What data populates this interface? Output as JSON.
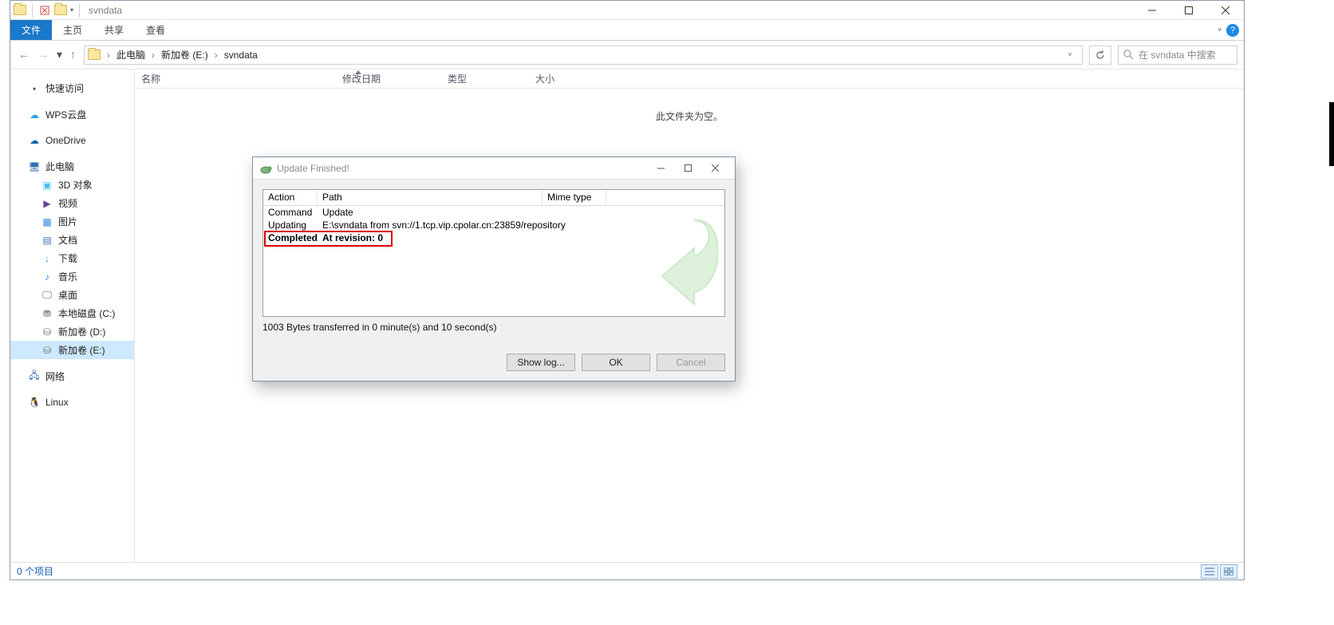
{
  "titlebar": {
    "title": "svndata"
  },
  "ribbon": {
    "file": "文件",
    "home": "主页",
    "share": "共享",
    "view": "查看"
  },
  "breadcrumb": {
    "parts": [
      "此电脑",
      "新加卷 (E:)",
      "svndata"
    ]
  },
  "search": {
    "placeholder": "在 svndata 中搜索"
  },
  "nav": {
    "quick": "快速访问",
    "wps": "WPS云盘",
    "onedrive": "OneDrive",
    "thispc": "此电脑",
    "pc_children": {
      "threeD": "3D 对象",
      "videos": "视频",
      "pictures": "图片",
      "documents": "文档",
      "downloads": "下载",
      "music": "音乐",
      "desktop": "桌面",
      "c": "本地磁盘 (C:)",
      "d": "新加卷 (D:)",
      "e": "新加卷 (E:)"
    },
    "network": "网络",
    "linux": "Linux"
  },
  "columns": {
    "name": "名称",
    "date": "修改日期",
    "type": "类型",
    "size": "大小"
  },
  "content": {
    "empty_msg": "此文件夹为空。"
  },
  "status": {
    "items": "0 个项目"
  },
  "dialog": {
    "title": "Update Finished!",
    "cols": {
      "action": "Action",
      "path": "Path",
      "mime": "Mime type"
    },
    "rows": [
      {
        "action": "Command",
        "path": "Update"
      },
      {
        "action": "Updating",
        "path": "E:\\svndata from svn://1.tcp.vip.cpolar.cn:23859/repository"
      },
      {
        "action": "Completed",
        "path": "At revision: 0"
      }
    ],
    "transfer": "1003 Bytes transferred in 0 minute(s) and 10 second(s)",
    "buttons": {
      "showlog": "Show log...",
      "ok": "OK",
      "cancel": "Cancel"
    }
  }
}
